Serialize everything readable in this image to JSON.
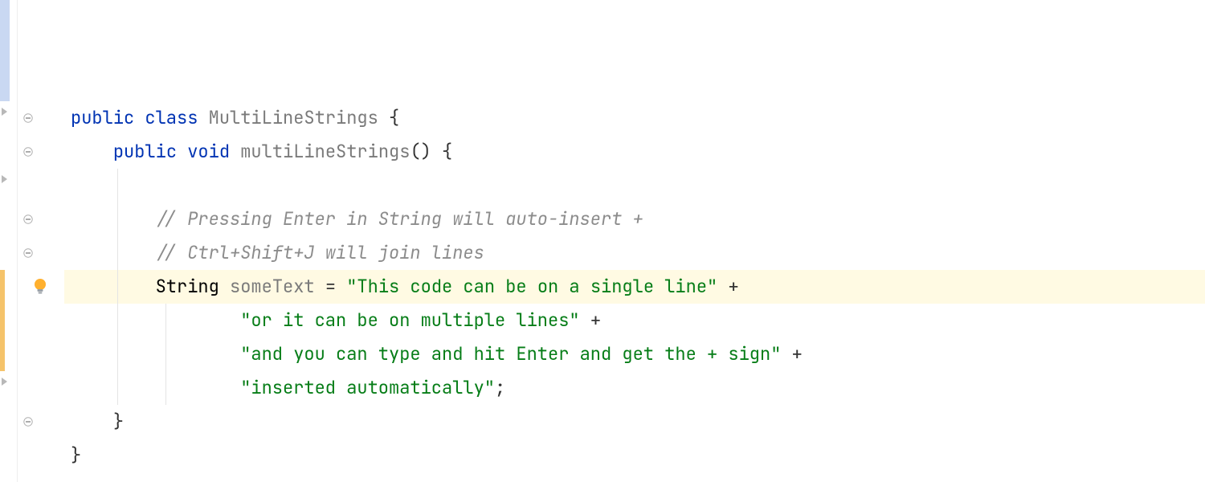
{
  "tokens": {
    "kw_public": "public",
    "kw_class": "class",
    "kw_void": "void",
    "cls_name": "MultiLineStrings",
    "method_name": "multiLineStrings",
    "type_string": "String",
    "var_name": "someText",
    "brace_open": "{",
    "brace_close": "}",
    "parens": "()",
    "eq": "=",
    "plus": "+",
    "semi": ";"
  },
  "comments": {
    "c1": "// Pressing Enter in String will auto-insert +",
    "c2": "// Ctrl+Shift+J will join lines"
  },
  "strings": {
    "s1": "\"This code can be on a single line\"",
    "s2": "\"or it can be on multiple lines\"",
    "s3": "\"and you can type and hit Enter and get the + sign\"",
    "s4": "\"inserted automatically\""
  },
  "colors": {
    "keyword": "#0033b3",
    "identifier_grey": "#7a7a7a",
    "comment": "#8c8c8c",
    "string": "#067d17",
    "highlight_line_bg": "#fffae3",
    "gutter_mod": "#f5c36a",
    "gutter_add": "#c9d8f2"
  },
  "icons": {
    "bulb": "lightbulb-icon",
    "fold_minus": "fold-collapse-icon",
    "arrow": "region-arrow-icon"
  }
}
